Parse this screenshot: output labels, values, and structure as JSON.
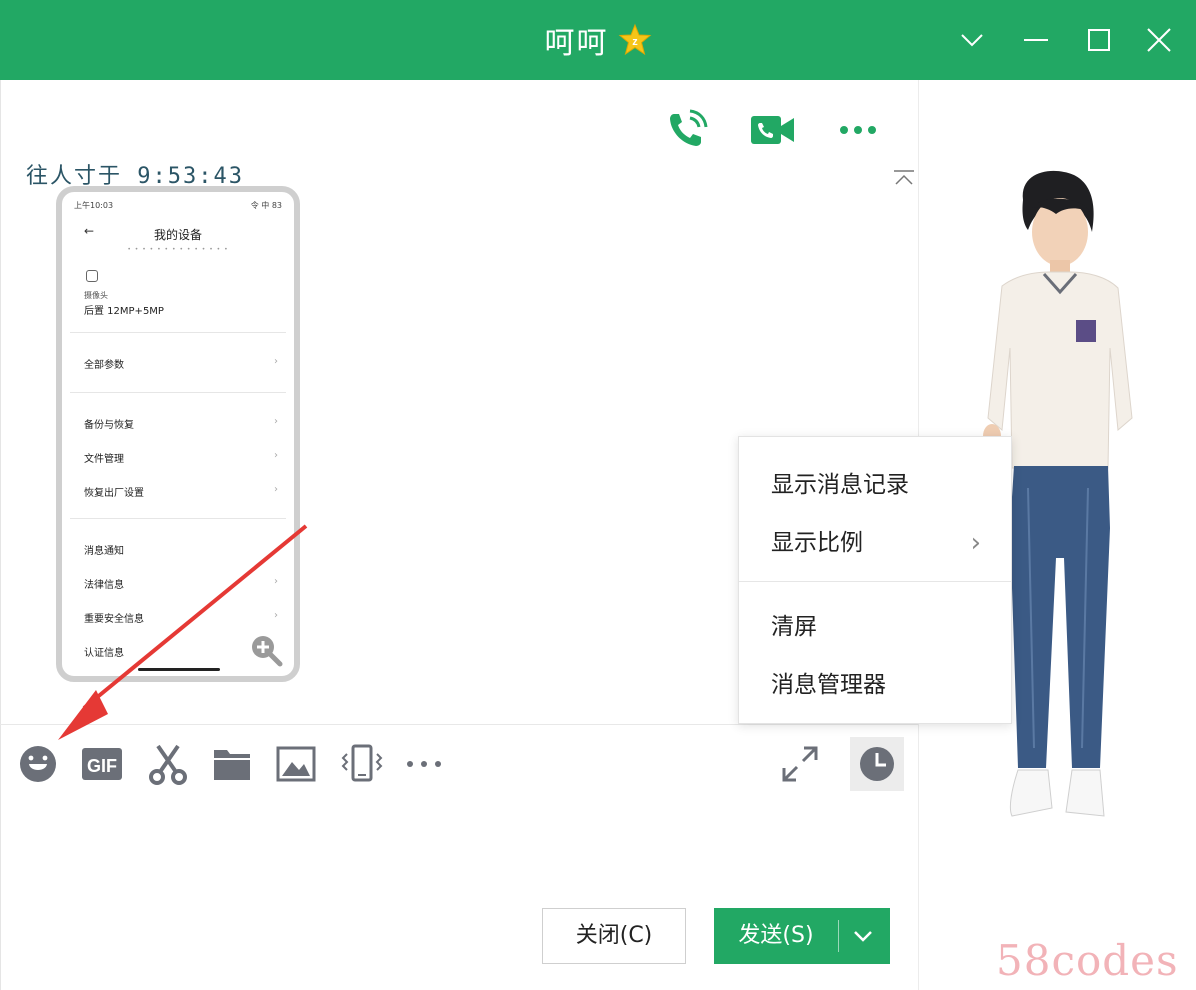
{
  "window": {
    "title": "呵呵",
    "badge_icon": "star-badge-icon",
    "controls": [
      "chevron-down-icon",
      "minimize-icon",
      "maximize-icon",
      "close-icon"
    ]
  },
  "header_actions": [
    "voice-call-icon",
    "video-call-icon",
    "more-icon"
  ],
  "message": {
    "sender_time": "往人寸于   9:53:43"
  },
  "phone_screenshot": {
    "status_left": "上午10:03",
    "status_right": "令 中 83",
    "back_arrow": "←",
    "title": "我的设备",
    "subtitle_dots": "• • • • • • • • • • • • • •",
    "camera_small_label": "摄像头",
    "camera_main_label": "后置 12MP+5MP",
    "rows": [
      {
        "label": "全部参数",
        "arrow": "›"
      },
      {
        "label": "备份与恢复",
        "arrow": "›"
      },
      {
        "label": "文件管理",
        "arrow": "›"
      },
      {
        "label": "恢复出厂设置",
        "arrow": "›"
      },
      {
        "label": "消息通知",
        "arrow": ""
      },
      {
        "label": "法律信息",
        "arrow": "›"
      },
      {
        "label": "重要安全信息",
        "arrow": "›"
      },
      {
        "label": "认证信息",
        "arrow": ""
      }
    ],
    "zoom_icon": "zoom-in-icon"
  },
  "toolbar": {
    "tools": [
      "emoji-icon",
      "gif-icon",
      "scissors-icon",
      "folder-icon",
      "image-icon",
      "shake-icon",
      "more-dots-icon"
    ],
    "right_tools": [
      "expand-icon",
      "clock-icon"
    ]
  },
  "context_menu": {
    "items": [
      {
        "label": "显示消息记录"
      },
      {
        "label": "显示比例",
        "submenu": "›"
      },
      {
        "label": "清屏"
      },
      {
        "label": "消息管理器"
      }
    ]
  },
  "buttons": {
    "close_label": "关闭(C)",
    "send_label": "发送(S)"
  },
  "watermark": "58codes",
  "colors": {
    "brand_green": "#22a864",
    "annotation_red": "#e53935"
  }
}
